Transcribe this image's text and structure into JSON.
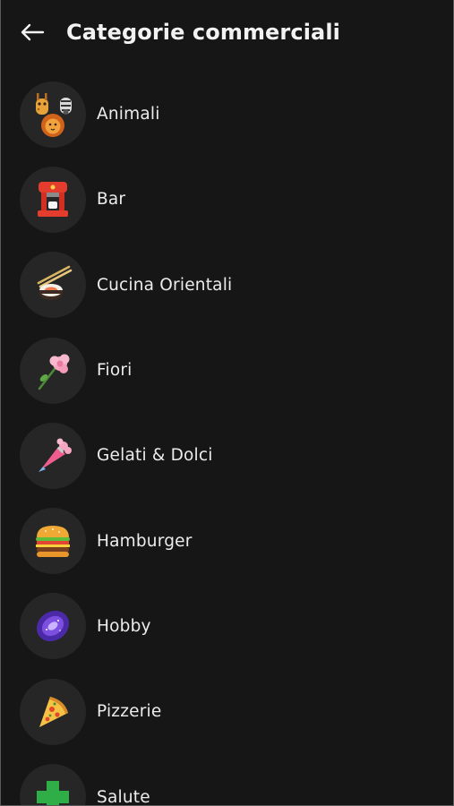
{
  "header": {
    "back_icon": "arrow-left-icon",
    "title": "Categorie commerciali"
  },
  "categories": [
    {
      "label": "Animali",
      "icon": "animals-icon"
    },
    {
      "label": "Bar",
      "icon": "coffee-machine-icon"
    },
    {
      "label": "Cucina Orientali",
      "icon": "sushi-chopsticks-icon"
    },
    {
      "label": "Fiori",
      "icon": "flower-icon"
    },
    {
      "label": "Gelati & Dolci",
      "icon": "piping-bag-icon"
    },
    {
      "label": "Hamburger",
      "icon": "hamburger-icon"
    },
    {
      "label": "Hobby",
      "icon": "galaxy-icon"
    },
    {
      "label": "Pizzerie",
      "icon": "pizza-slice-icon"
    },
    {
      "label": "Salute",
      "icon": "green-cross-icon"
    }
  ],
  "colors": {
    "background": "#161616",
    "avatar": "#262626",
    "text": "#ececec"
  }
}
